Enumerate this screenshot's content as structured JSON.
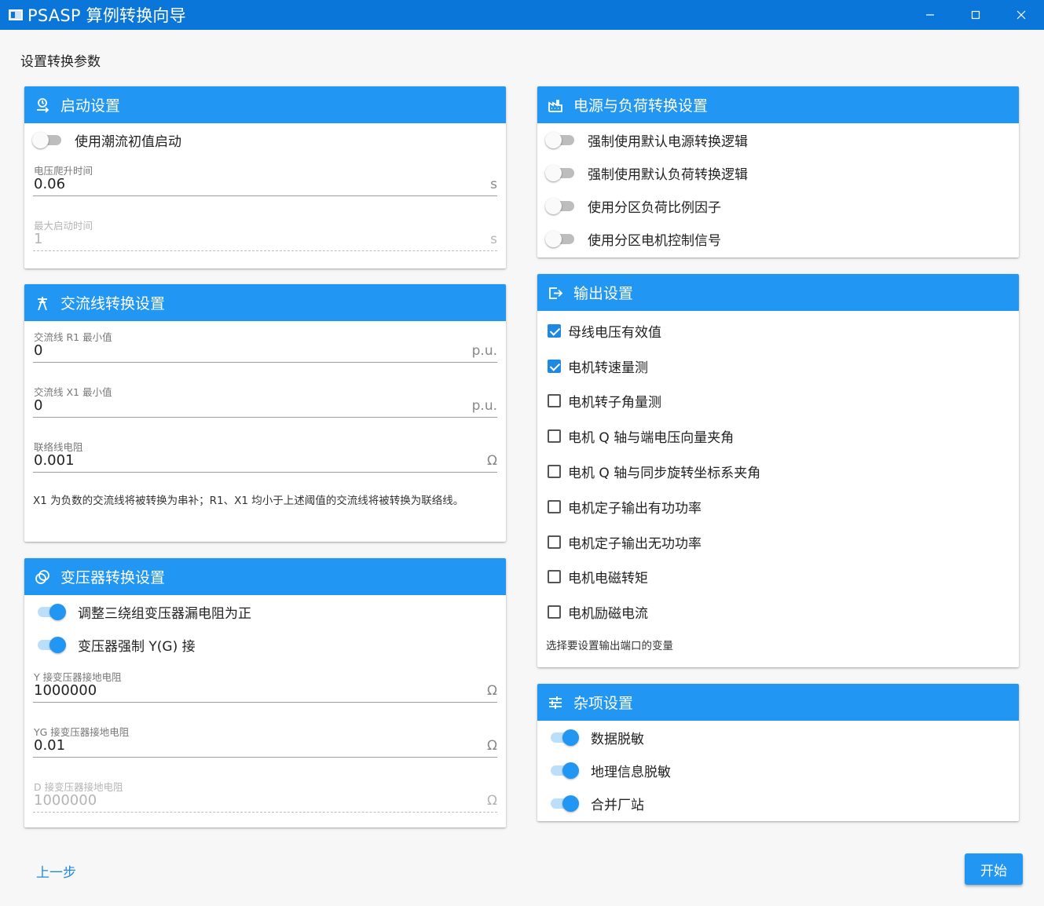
{
  "window": {
    "title": "PSASP 算例转换向导"
  },
  "page": {
    "section_label": "设置转换参数"
  },
  "startup": {
    "title": "启动设置",
    "toggle_label": "使用潮流初值启动",
    "toggle_on": false,
    "ramp_label": "电压爬升时间",
    "ramp_value": "0.06",
    "ramp_unit": "s",
    "max_label": "最大启动时间",
    "max_value": "1",
    "max_unit": "s"
  },
  "acline": {
    "title": "交流线转换设置",
    "r1_label": "交流线 R1 最小值",
    "r1_value": "0",
    "r1_unit": "p.u.",
    "x1_label": "交流线 X1 最小值",
    "x1_value": "0",
    "x1_unit": "p.u.",
    "tie_label": "联络线电阻",
    "tie_value": "0.001",
    "tie_unit": "Ω",
    "note": "X1 为负数的交流线将被转换为串补；R1、X1 均小于上述阈值的交流线将被转换为联络线。"
  },
  "transformer": {
    "title": "变压器转换设置",
    "toggle1_label": "调整三绕组变压器漏电阻为正",
    "toggle2_label": "变压器强制 Y(G) 接",
    "y_label": "Y 接变压器接地电阻",
    "y_value": "1000000",
    "y_unit": "Ω",
    "yg_label": "YG 接变压器接地电阻",
    "yg_value": "0.01",
    "yg_unit": "Ω",
    "d_label": "D 接变压器接地电阻",
    "d_value": "1000000",
    "d_unit": "Ω"
  },
  "power_load": {
    "title": "电源与负荷转换设置",
    "items": [
      {
        "label": "强制使用默认电源转换逻辑",
        "on": false
      },
      {
        "label": "强制使用默认负荷转换逻辑",
        "on": false
      },
      {
        "label": "使用分区负荷比例因子",
        "on": false
      },
      {
        "label": "使用分区电机控制信号",
        "on": false
      }
    ]
  },
  "output": {
    "title": "输出设置",
    "items": [
      {
        "label": "母线电压有效值",
        "checked": true
      },
      {
        "label": "电机转速量测",
        "checked": true
      },
      {
        "label": "电机转子角量测",
        "checked": false
      },
      {
        "label": "电机 Q 轴与端电压向量夹角",
        "checked": false
      },
      {
        "label": "电机 Q 轴与同步旋转坐标系夹角",
        "checked": false
      },
      {
        "label": "电机定子输出有功功率",
        "checked": false
      },
      {
        "label": "电机定子输出无功功率",
        "checked": false
      },
      {
        "label": "电机电磁转矩",
        "checked": false
      },
      {
        "label": "电机励磁电流",
        "checked": false
      }
    ],
    "hint": "选择要设置输出端口的变量"
  },
  "misc": {
    "title": "杂项设置",
    "items": [
      {
        "label": "数据脱敏",
        "on": true
      },
      {
        "label": "地理信息脱敏",
        "on": true
      },
      {
        "label": "合并厂站",
        "on": true
      }
    ]
  },
  "footer": {
    "prev_label": "上一步",
    "start_label": "开始"
  },
  "colors": {
    "accent": "#2196f3",
    "titlebar": "#0b76d9"
  }
}
